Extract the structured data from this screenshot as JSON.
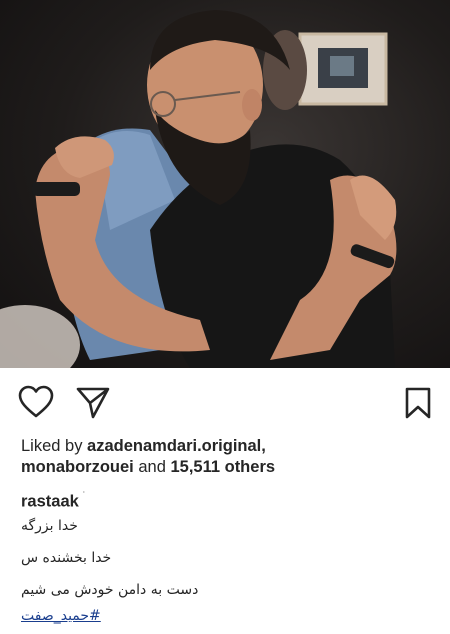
{
  "post": {
    "image_description_label": "post-photo",
    "likes": {
      "prefix": "Liked by ",
      "first_user": "azadenamdari.original,",
      "second_user": "monaborzouei",
      "connector": " and ",
      "count_text": "15,511 others"
    },
    "author": "rastaak",
    "author_mark": "ˈ",
    "caption_lines": [
      "خدا بزرگه",
      "خدا بخشنده س",
      "دست به دامن خودش می شیم"
    ],
    "hashtag": "#حمید_صفت"
  },
  "colors": {
    "text": "#262626",
    "hashtag": "#1a3e8e"
  }
}
